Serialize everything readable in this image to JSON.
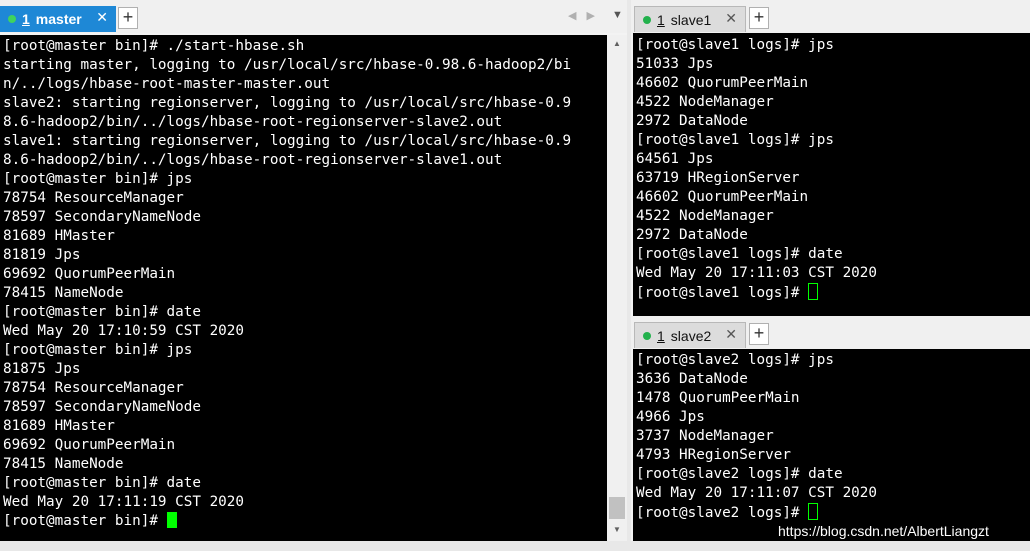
{
  "master": {
    "tab": {
      "num": "1",
      "name": "master",
      "close": "✕"
    },
    "lines": [
      "[root@master bin]# ./start-hbase.sh",
      "starting master, logging to /usr/local/src/hbase-0.98.6-hadoop2/bi",
      "n/../logs/hbase-root-master-master.out",
      "slave2: starting regionserver, logging to /usr/local/src/hbase-0.9",
      "8.6-hadoop2/bin/../logs/hbase-root-regionserver-slave2.out",
      "slave1: starting regionserver, logging to /usr/local/src/hbase-0.9",
      "8.6-hadoop2/bin/../logs/hbase-root-regionserver-slave1.out",
      "[root@master bin]# jps",
      "78754 ResourceManager",
      "78597 SecondaryNameNode",
      "81689 HMaster",
      "81819 Jps",
      "69692 QuorumPeerMain",
      "78415 NameNode",
      "[root@master bin]# date",
      "Wed May 20 17:10:59 CST 2020",
      "[root@master bin]# jps",
      "81875 Jps",
      "78754 ResourceManager",
      "78597 SecondaryNameNode",
      "81689 HMaster",
      "69692 QuorumPeerMain",
      "78415 NameNode",
      "[root@master bin]# date",
      "Wed May 20 17:11:19 CST 2020"
    ],
    "prompt": "[root@master bin]# "
  },
  "slave1": {
    "tab": {
      "num": "1",
      "name": "slave1",
      "close": "✕"
    },
    "lines": [
      "[root@slave1 logs]# jps",
      "51033 Jps",
      "46602 QuorumPeerMain",
      "4522 NodeManager",
      "2972 DataNode",
      "[root@slave1 logs]# jps",
      "64561 Jps",
      "63719 HRegionServer",
      "46602 QuorumPeerMain",
      "4522 NodeManager",
      "2972 DataNode",
      "[root@slave1 logs]# date",
      "Wed May 20 17:11:03 CST 2020"
    ],
    "prompt": "[root@slave1 logs]# "
  },
  "slave2": {
    "tab": {
      "num": "1",
      "name": "slave2",
      "close": "✕"
    },
    "lines": [
      "[root@slave2 logs]# jps",
      "3636 DataNode",
      "1478 QuorumPeerMain",
      "4966 Jps",
      "3737 NodeManager",
      "4793 HRegionServer",
      "[root@slave2 logs]# date",
      "Wed May 20 17:11:07 CST 2020"
    ],
    "prompt": "[root@slave2 logs]# "
  },
  "ui": {
    "plus": "+",
    "nav_arrows": "◀▶",
    "nav_down": "▼",
    "scroll_up": "▲",
    "scroll_down": "▼"
  },
  "watermark": "https://blog.csdn.net/AlbertLiangzt",
  "colors": {
    "tab_active": "#1e88d6",
    "terminal_bg": "#000000",
    "cursor": "#00ff00",
    "status_dot": "#22b14c"
  }
}
